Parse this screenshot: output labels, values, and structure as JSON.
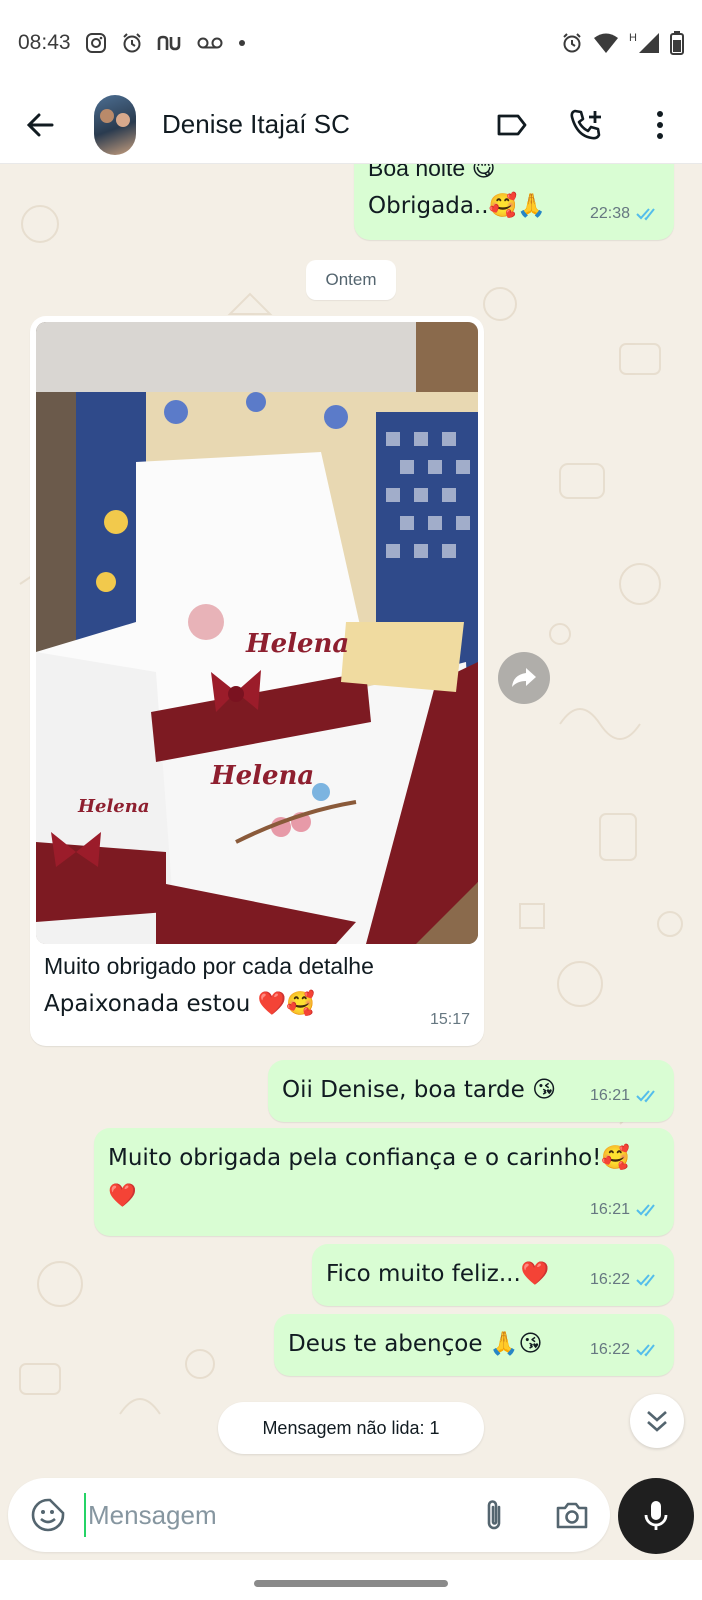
{
  "status_bar": {
    "time": "08:43",
    "left_icons": [
      "instagram-icon",
      "alarm-icon",
      "nubank-icon",
      "voicemail-icon",
      "dot-icon"
    ],
    "network_label": "H",
    "right_icons": [
      "alarm-icon",
      "wifi-icon",
      "signal-icon",
      "battery-icon"
    ]
  },
  "header": {
    "contact_name": "Denise Itajaí SC",
    "actions": [
      "label-icon",
      "add-call-icon",
      "more-icon"
    ]
  },
  "messages": [
    {
      "direction": "out",
      "text_partial": "Boa noite 😋",
      "text": "Obrigada..🥰🙏",
      "time": "22:38",
      "status": "read"
    },
    {
      "type": "date",
      "text": "Ontem"
    },
    {
      "direction": "in",
      "type": "image",
      "caption_line1": "Muito obrigado por cada detalhe",
      "caption_line2": "Apaixonada estou ❤️🥰",
      "time": "15:17",
      "image_texts": [
        "Helena",
        "Helena",
        "Helena"
      ]
    },
    {
      "direction": "out",
      "text": "Oii Denise, boa tarde 😘",
      "time": "16:21",
      "status": "read"
    },
    {
      "direction": "out",
      "text_line1": "Muito obrigada pela confiança e o carinho!🥰",
      "text_line2": "❤️",
      "time": "16:21",
      "status": "read"
    },
    {
      "direction": "out",
      "text": "Fico muito feliz...❤️",
      "time": "16:22",
      "status": "read"
    },
    {
      "direction": "out",
      "text": "Deus te abençoe 🙏😘",
      "time": "16:22",
      "status": "read"
    }
  ],
  "unread_label": "Mensagem não lida: 1",
  "composer": {
    "placeholder": "Mensagem"
  },
  "colors": {
    "outgoing_bubble": "#d9fdd3",
    "incoming_bubble": "#ffffff",
    "read_ticks": "#53bdeb",
    "chat_background": "#f4efe6"
  }
}
